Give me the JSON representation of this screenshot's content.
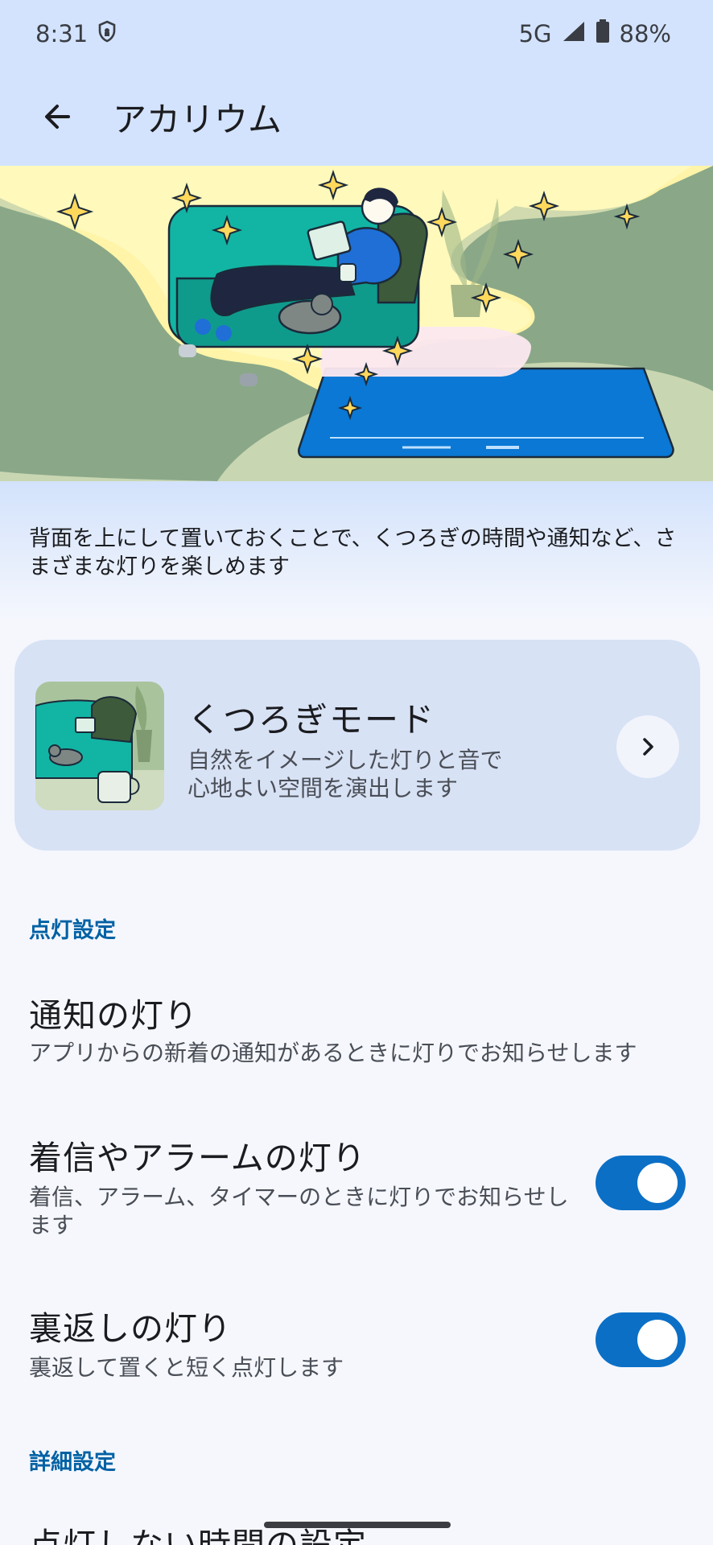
{
  "status_bar": {
    "time": "8:31",
    "network": "5G",
    "battery": "88%",
    "icons": [
      "vpn-shield-icon",
      "signal-icon",
      "battery-icon"
    ]
  },
  "app_bar": {
    "back_icon": "arrow-left-icon",
    "title": "アカリウム"
  },
  "intro": {
    "text": "背面を上にして置いておくことで、くつろぎの時間や通知など、さまざまな灯りを楽しめます"
  },
  "relax_card": {
    "title": "くつろぎモード",
    "description": "自然をイメージした灯りと音で心地よい空間を演出します",
    "chevron_icon": "chevron-right-icon"
  },
  "lighting_section": {
    "header": "点灯設定",
    "items": [
      {
        "title": "通知の灯り",
        "description": "アプリからの新着の通知があるときに灯りでお知らせします"
      },
      {
        "title": "着信やアラームの灯り",
        "description": "着信、アラーム、タイマーのときに灯りでお知らせします",
        "enabled": true
      },
      {
        "title": "裏返しの灯り",
        "description": "裏返して置くと短く点灯します",
        "enabled": true
      }
    ]
  },
  "detail_section": {
    "header": "詳細設定",
    "items": [
      {
        "title": "点灯しない時間の設定"
      }
    ]
  },
  "colors": {
    "accent": "#0061a4",
    "toggle_on": "#0b6fc6",
    "header_bg": "#d3e3fd",
    "card_bg": "#d8e2f5"
  }
}
